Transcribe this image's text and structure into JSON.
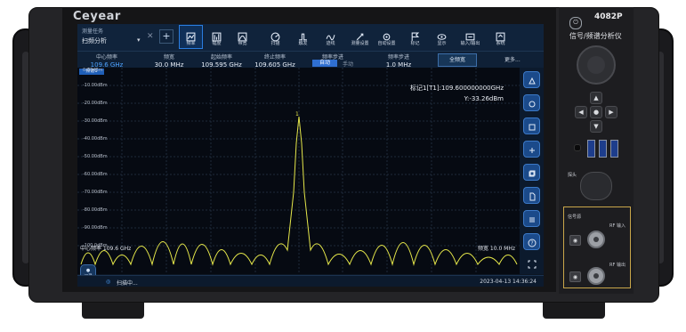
{
  "device": {
    "brand": "Ceyear",
    "model": "4082P",
    "title": "信号/频谱分析仪"
  },
  "mode": {
    "label": "测量任务",
    "value": "扫频分析"
  },
  "toolbar": [
    {
      "label": "频率",
      "icon": "frequency-icon",
      "active": true
    },
    {
      "label": "幅度",
      "icon": "amplitude-icon"
    },
    {
      "label": "带宽",
      "icon": "bandwidth-icon"
    },
    {
      "label": "扫描",
      "icon": "sweep-icon"
    },
    {
      "label": "触发",
      "icon": "trigger-icon"
    },
    {
      "label": "迹线",
      "icon": "trace-icon"
    },
    {
      "label": "测量设置",
      "icon": "measure-setup-icon"
    },
    {
      "label": "自动设置",
      "icon": "auto-setup-icon"
    },
    {
      "label": "标记",
      "icon": "marker-icon"
    },
    {
      "label": "显示",
      "icon": "display-icon"
    },
    {
      "label": "输入/输出",
      "icon": "input-output-icon"
    },
    {
      "label": "系统",
      "icon": "system-icon"
    }
  ],
  "params": {
    "center": {
      "label": "中心频率",
      "value": "109.6 GHz"
    },
    "span": {
      "label": "频宽",
      "value": "30.0 MHz"
    },
    "start": {
      "label": "起始频率",
      "value": "109.595 GHz"
    },
    "stop": {
      "label": "终止频率",
      "value": "109.605 GHz"
    },
    "step_mode": {
      "label": "频率步进",
      "auto": "自动",
      "manual": "手动"
    },
    "step": {
      "label": "频率步进",
      "value": "1.0 MHz"
    },
    "full_span": "全频宽",
    "more": "更多..."
  },
  "plot": {
    "trace_tab": "频谱1",
    "ref_level": "0.00dBm",
    "y_labels": [
      "-10.00dBm",
      "-20.00dBm",
      "-30.00dBm",
      "-40.00dBm",
      "-50.00dBm",
      "-60.00dBm",
      "-70.00dBm",
      "-80.00dBm",
      "-90.00dBm",
      "-100.0dBm"
    ],
    "marker_line1": "标记1[T1]:109.600000000GHz",
    "marker_line2": "Y:-33.26dBm",
    "x_left": "中心频率 109.6 GHz",
    "x_right": "频宽 10.0 MHz",
    "trace_color": "#e6e84a"
  },
  "status": {
    "record_label": "记录",
    "state": "扫描中...",
    "time": "2023-04-13 14:36:24"
  },
  "side_icons": [
    "preset-icon",
    "marker-search-icon",
    "save-icon",
    "recall-icon",
    "copy-icon",
    "file-icon",
    "list-icon",
    "help-icon",
    "fullscreen-icon"
  ],
  "front_panel": {
    "power": "⏻",
    "usb_label": "USB",
    "probe_label": "探头",
    "gen_label": "信号源",
    "rf_in": "RF 输入",
    "rf_out": "RF 输出"
  }
}
